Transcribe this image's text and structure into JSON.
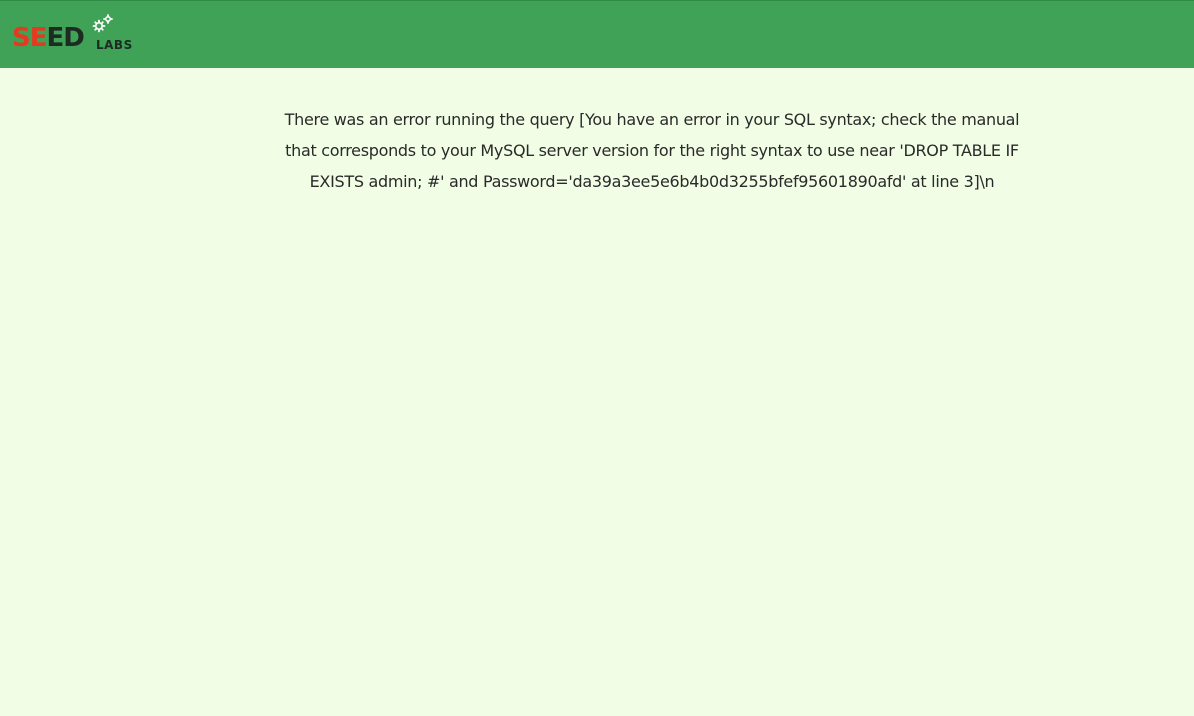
{
  "header": {
    "logo": {
      "seed_part1": "SE",
      "seed_part2": "ED",
      "labs": "LABS",
      "icon": "gears-icon",
      "colors": {
        "red": "#e53a1f",
        "dark": "#1d2b22"
      }
    },
    "background": "#3fa257"
  },
  "main": {
    "background": "#f1fde5",
    "error_message": "There was an error running the query [You have an error in your SQL syntax; check the manual that corresponds to your MySQL server version for the right syntax to use near 'DROP TABLE IF EXISTS admin; #' and Password='da39a3ee5e6b4b0d3255bfef95601890afd' at line 3]\\n"
  }
}
